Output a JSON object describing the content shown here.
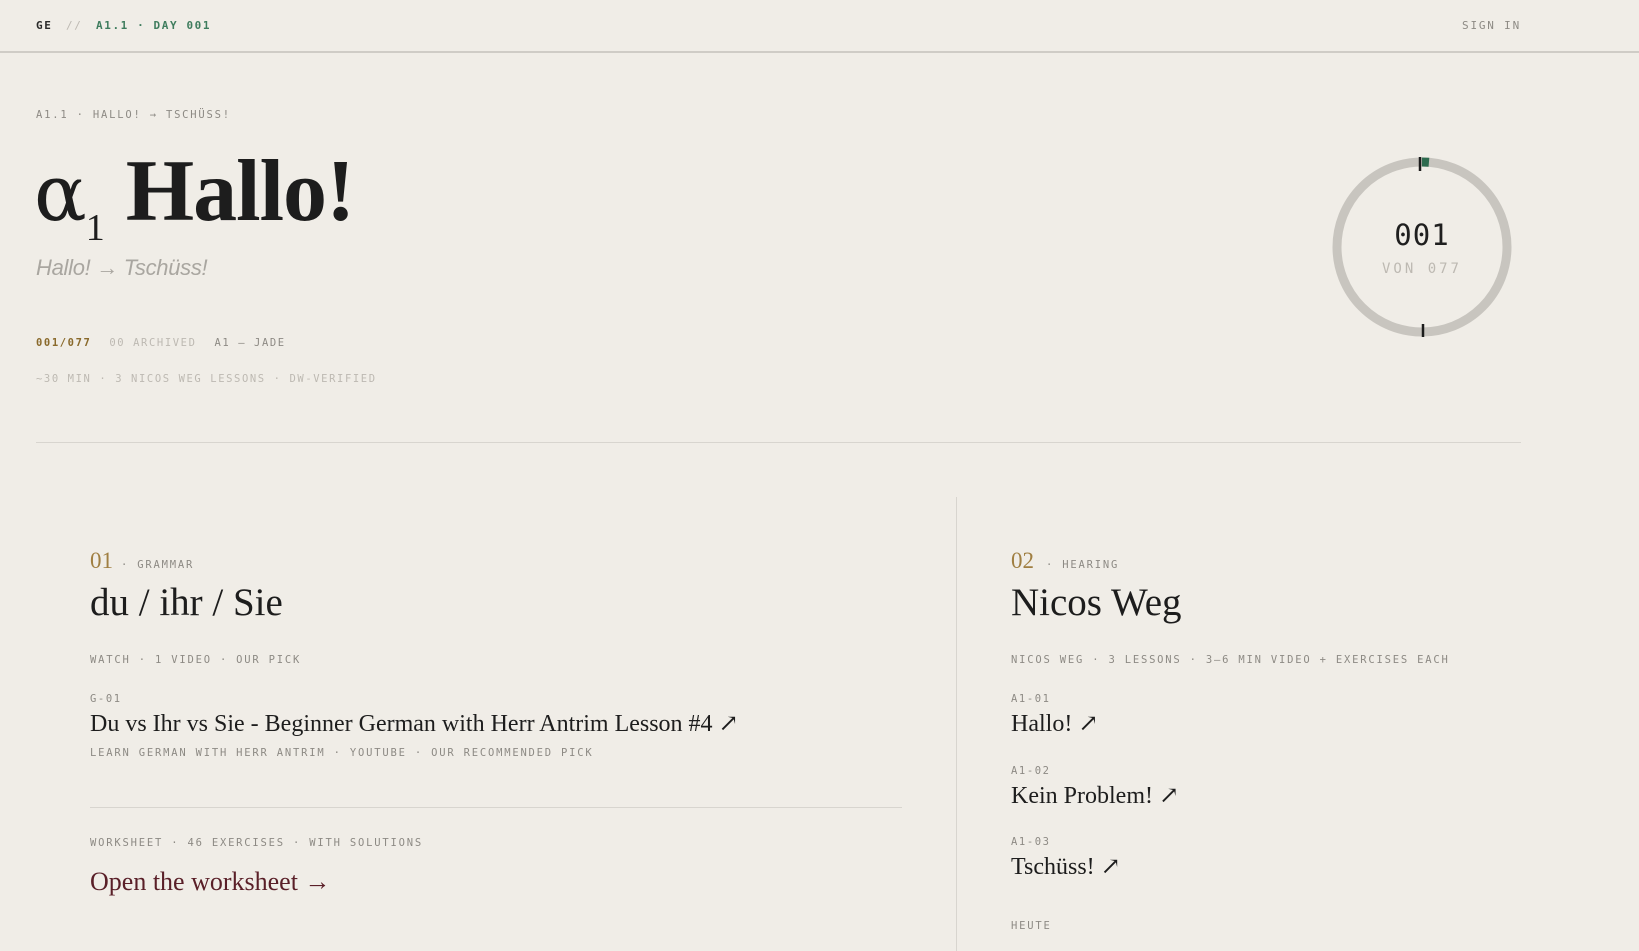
{
  "topbar": {
    "brand": "GE",
    "separator": "//",
    "breadcrumb": "A1.1 · DAY 001",
    "sign_in": "SIGN IN"
  },
  "hero": {
    "eyebrow": "A1.1 · HALLO! → TSCHÜSS!",
    "alpha": "α",
    "alpha_sub": "1",
    "title": "Hallo!",
    "subtitle": "Hallo! → Tschüss!",
    "count": "001/077",
    "archived": "00 ARCHIVED",
    "level": "A1 — JADE",
    "details": "~30 MIN · 3 NICOS WEG LESSONS · DW-VERIFIED"
  },
  "progress": {
    "current": "001",
    "of_label": "VON 077",
    "fraction": 0.013,
    "track_color": "#c8c5bf",
    "fill_color": "#2e6b4f"
  },
  "grammar": {
    "number": "01",
    "kind": "· GRAMMAR",
    "title": "du / ihr / Sie",
    "watch_meta": "WATCH · 1 VIDEO · OUR PICK",
    "video": {
      "code": "G-01",
      "title": "Du vs Ihr vs Sie - Beginner German with Herr Antrim Lesson #4 ↗",
      "source": "LEARN GERMAN WITH HERR ANTRIM · YOUTUBE · OUR RECOMMENDED PICK"
    },
    "worksheet_meta": "WORKSHEET · 46 EXERCISES · WITH SOLUTIONS",
    "worksheet_link": "Open the worksheet →"
  },
  "hearing": {
    "number": "02",
    "kind": "· HEARING",
    "title": "Nicos Weg",
    "meta": "NICOS WEG · 3 LESSONS · 3–6 MIN VIDEO + EXERCISES EACH",
    "lessons": [
      {
        "code": "A1-01",
        "title": "Hallo! ↗"
      },
      {
        "code": "A1-02",
        "title": "Kein Problem! ↗"
      },
      {
        "code": "A1-03",
        "title": "Tschüss! ↗"
      }
    ],
    "today_label": "HEUTE"
  }
}
